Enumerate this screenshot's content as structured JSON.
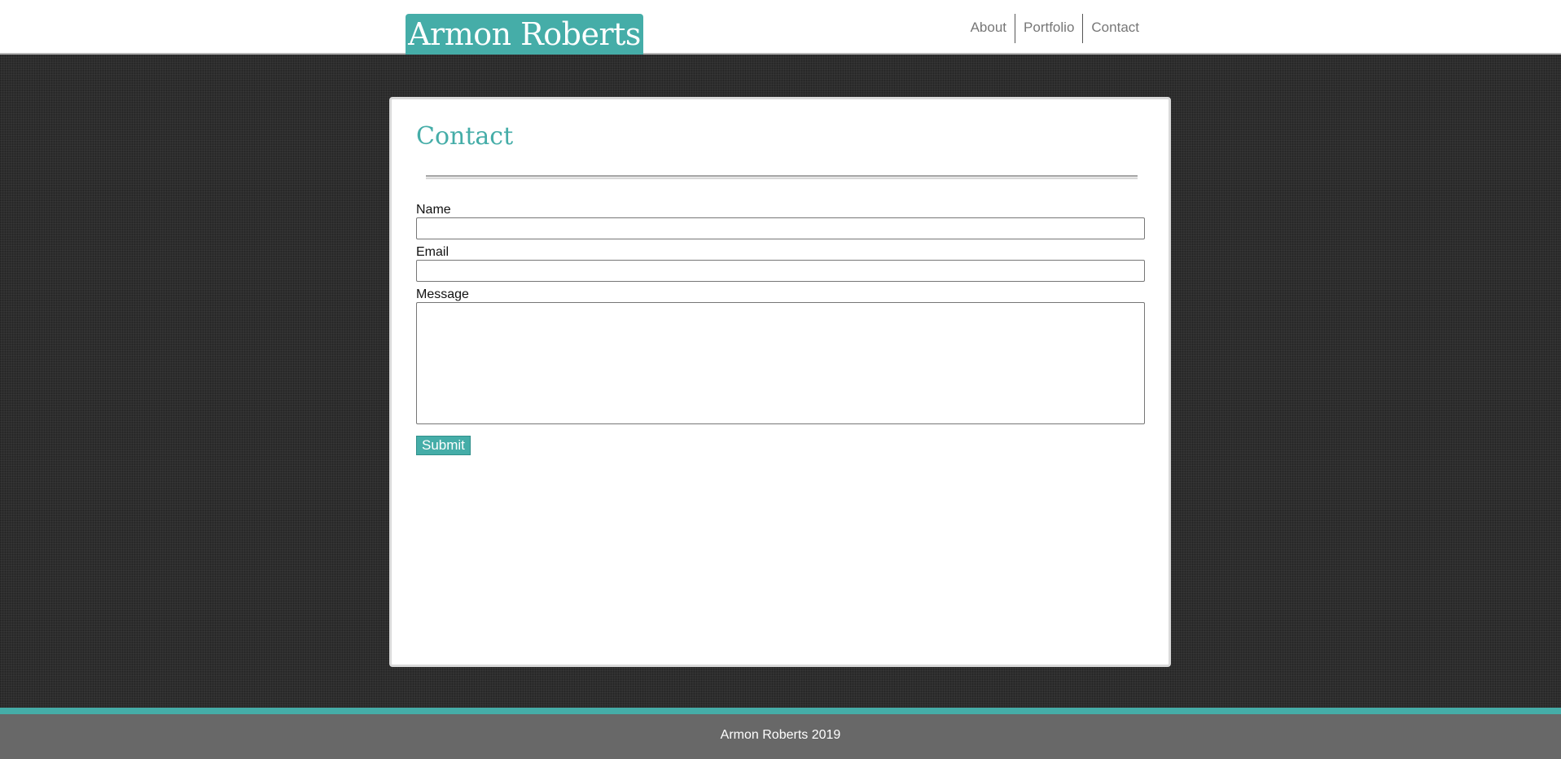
{
  "header": {
    "logo_text": "Armon Roberts",
    "nav": [
      {
        "label": "About"
      },
      {
        "label": "Portfolio"
      },
      {
        "label": "Contact"
      }
    ]
  },
  "main": {
    "title": "Contact",
    "form": {
      "name_label": "Name",
      "name_value": "",
      "email_label": "Email",
      "email_value": "",
      "message_label": "Message",
      "message_value": "",
      "submit_label": "Submit"
    }
  },
  "footer": {
    "text": "Armon Roberts 2019"
  },
  "colors": {
    "accent": "#45ada8",
    "background": "#2e2e2e",
    "footer": "#686868"
  }
}
